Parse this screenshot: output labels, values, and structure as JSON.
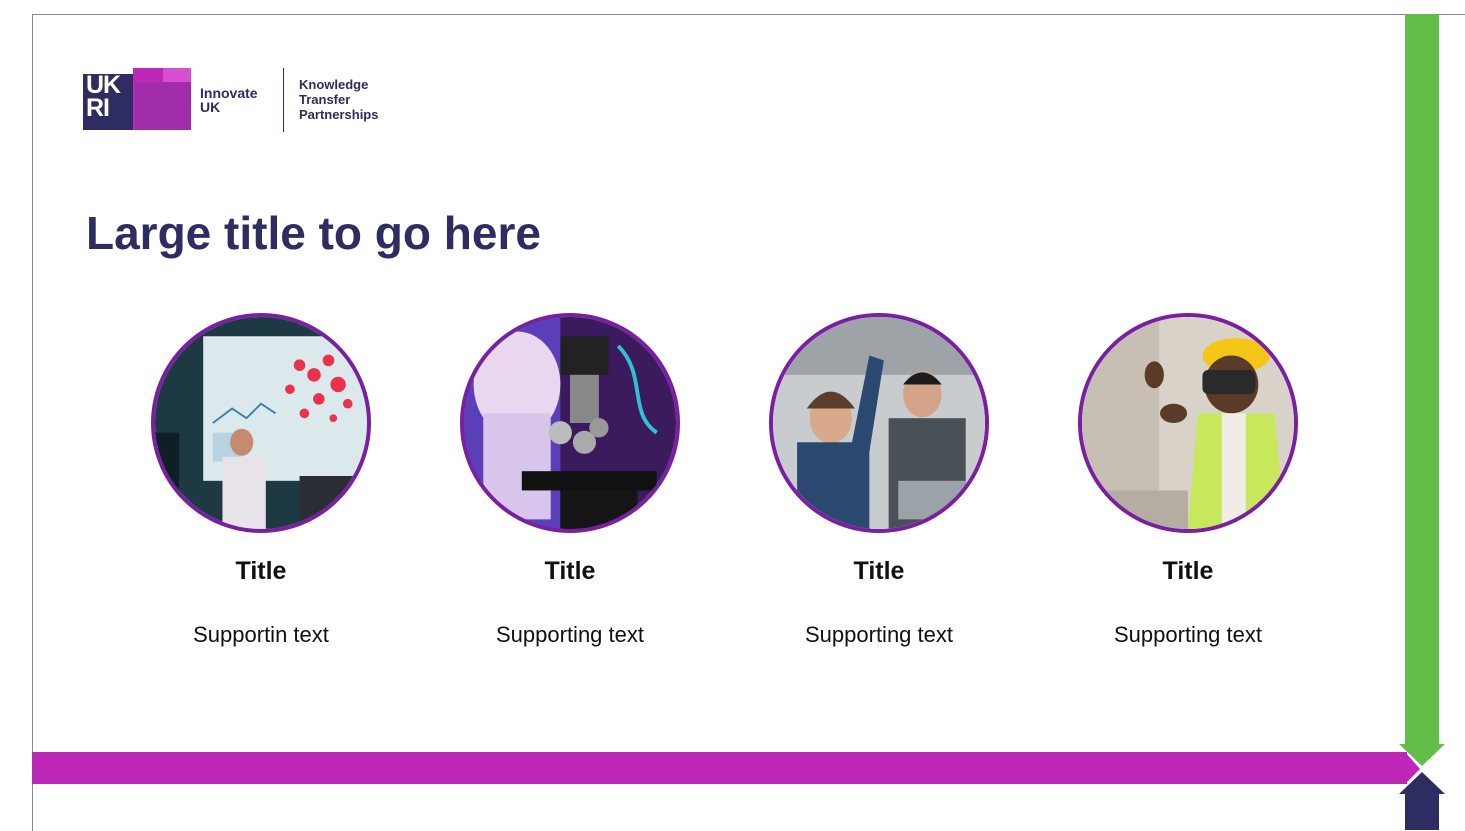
{
  "logo": {
    "ukri_letters": "UK RI",
    "innovate_line1": "Innovate",
    "innovate_line2": "UK",
    "ktp_line1": "Knowledge",
    "ktp_line2": "Transfer",
    "ktp_line3": "Partnerships"
  },
  "title": "Large title to go here",
  "cards": [
    {
      "title": "Title",
      "text": "Supportin text",
      "image": "presentation-data-wall"
    },
    {
      "title": "Title",
      "text": "Supporting text",
      "image": "microscope-lab"
    },
    {
      "title": "Title",
      "text": "Supporting text",
      "image": "engineers-pointing"
    },
    {
      "title": "Title",
      "text": "Supporting text",
      "image": "vr-headset-worker"
    }
  ],
  "colors": {
    "navy": "#2e2d62",
    "magenta": "#be28b8",
    "green": "#62bd49",
    "circle_border": "#7b1fa2"
  }
}
